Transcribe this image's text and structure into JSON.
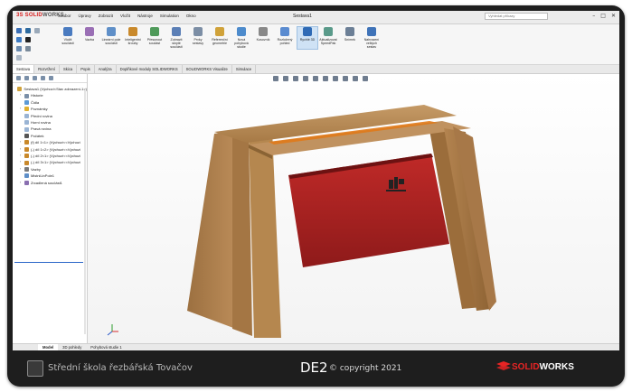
{
  "app": {
    "brand_a": "3S",
    "brand_b": "SOLID",
    "brand_c": "WORKS",
    "document_title": "Sestava1"
  },
  "menu": [
    "Soubor",
    "Úpravy",
    "Zobrazit",
    "Vložit",
    "Nástroje",
    "Simulation",
    "Okno"
  ],
  "search": {
    "placeholder": "Vyhledat příkazy"
  },
  "window_buttons": [
    "–",
    "□",
    "✕"
  ],
  "ribbon": {
    "commands": [
      {
        "label": "Vložit součásti",
        "icon": "insert-component-icon",
        "state": "normal"
      },
      {
        "label": "Vazba",
        "icon": "mate-icon",
        "state": "normal"
      },
      {
        "label": "Lineární pole součásti",
        "icon": "linear-pattern-icon",
        "state": "normal"
      },
      {
        "label": "Inteligentní šrouby",
        "icon": "smart-fasteners-icon",
        "state": "normal"
      },
      {
        "label": "Přesunout součást",
        "icon": "move-component-icon",
        "state": "normal"
      },
      {
        "label": "Zobrazit skryté součásti",
        "icon": "show-hidden-icon",
        "state": "normal"
      },
      {
        "label": "Prvky sestavy",
        "icon": "assembly-features-icon",
        "state": "normal"
      },
      {
        "label": "Referenční geometrie",
        "icon": "reference-geometry-icon",
        "state": "normal"
      },
      {
        "label": "Nová pohybová studie",
        "icon": "motion-study-icon",
        "state": "normal"
      },
      {
        "label": "Kusovník",
        "icon": "bom-icon",
        "state": "normal"
      },
      {
        "label": "Rozložený pohled",
        "icon": "exploded-view-icon",
        "state": "normal"
      },
      {
        "label": "Rychlé 3D",
        "icon": "instant3d-icon",
        "state": "active"
      },
      {
        "label": "Aktualizovat SpeedPak",
        "icon": "speedpak-icon",
        "state": "normal"
      },
      {
        "label": "Snímek",
        "icon": "snapshot-icon",
        "state": "normal"
      },
      {
        "label": "Nahrazení velkých sestav",
        "icon": "large-assembly-icon",
        "state": "normal"
      }
    ]
  },
  "tabs": [
    "Sestava",
    "Rozvržení",
    "Skica",
    "Popis",
    "Analýza",
    "Doplňkové moduly SOLIDWORKS",
    "SOLIDWORKS Visualize",
    "Simulace"
  ],
  "tree": [
    {
      "label": "Sestava1  (Výchozí<Stav zobrazení-1>)",
      "icon": "assembly-icon",
      "arrow": ""
    },
    {
      "label": "Historie",
      "icon": "history-icon",
      "arrow": "›"
    },
    {
      "label": "Čidla",
      "icon": "sensor-icon",
      "arrow": ""
    },
    {
      "label": "Poznámky",
      "icon": "annotation-icon",
      "arrow": "›"
    },
    {
      "label": "Přední rovina",
      "icon": "plane-icon",
      "arrow": ""
    },
    {
      "label": "Horní rovina",
      "icon": "plane-icon",
      "arrow": ""
    },
    {
      "label": "Pravá rovina",
      "icon": "plane-icon",
      "arrow": ""
    },
    {
      "label": "Počátek",
      "icon": "origin-icon",
      "arrow": ""
    },
    {
      "label": "(f) díl 1<1> (Výchozí<<Výchozí",
      "icon": "part-icon",
      "arrow": "›"
    },
    {
      "label": "(-) díl 1<2> (Výchozí<<Výchozí",
      "icon": "part-icon",
      "arrow": "›"
    },
    {
      "label": "(-) díl 2<1> (Výchozí<<Výchozí",
      "icon": "part-icon",
      "arrow": "›"
    },
    {
      "label": "(-) díl 3<1> (Výchozí<<Výchozí",
      "icon": "part-icon",
      "arrow": "›"
    },
    {
      "label": "Vazby",
      "icon": "mates-icon",
      "arrow": "›"
    },
    {
      "label": "MistniLinPole1",
      "icon": "pattern-icon",
      "arrow": ""
    },
    {
      "label": "Zrcadlená součást1",
      "icon": "mirror-icon",
      "arrow": "›"
    }
  ],
  "bottom_tabs": [
    "Model",
    "3D pohledy",
    "Pohybová studie 1"
  ],
  "banner": {
    "school": "Střední škola řezbářská Tovačov",
    "title": "DE2",
    "copyright": "© copyright 2021",
    "brand_a": "SOLID",
    "brand_b": "WORKS"
  },
  "colors": {
    "wood": "#b88a52",
    "wood_dark": "#8a6334",
    "steel_red": "#b32524",
    "brand_red": "#e82424",
    "frame": "#1e1e1e"
  }
}
